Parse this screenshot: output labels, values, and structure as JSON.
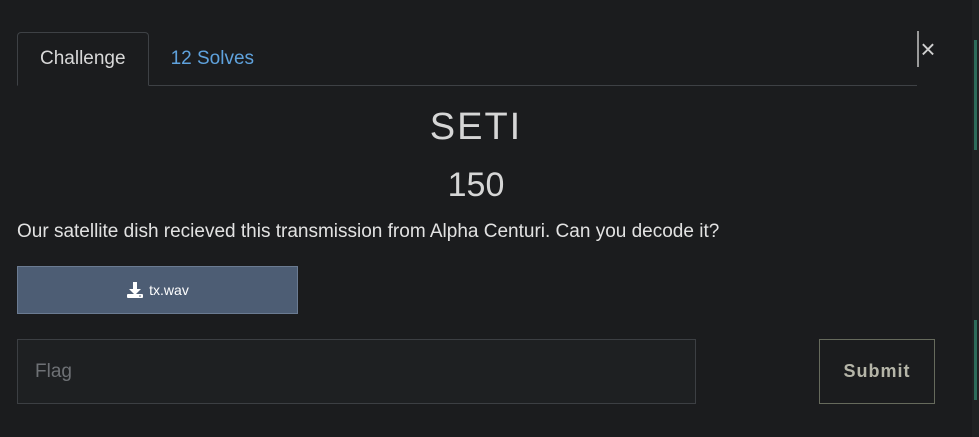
{
  "tabs": [
    {
      "label": "Challenge",
      "active": true
    },
    {
      "label": "12 Solves",
      "active": false
    }
  ],
  "close": {
    "icon": "close-icon",
    "glyph": "×"
  },
  "challenge": {
    "name": "SETI",
    "points": "150",
    "description": "Our satellite dish recieved this transmission from Alpha Centuri. Can you decode it?"
  },
  "file": {
    "icon": "download-icon",
    "name": "tx.wav"
  },
  "flag_form": {
    "placeholder": "Flag",
    "value": "",
    "submit_label": "Submit"
  },
  "colors": {
    "background": "#1b1c1e",
    "tab_link": "#5fa2dd",
    "file_button": "#4d5d74"
  }
}
